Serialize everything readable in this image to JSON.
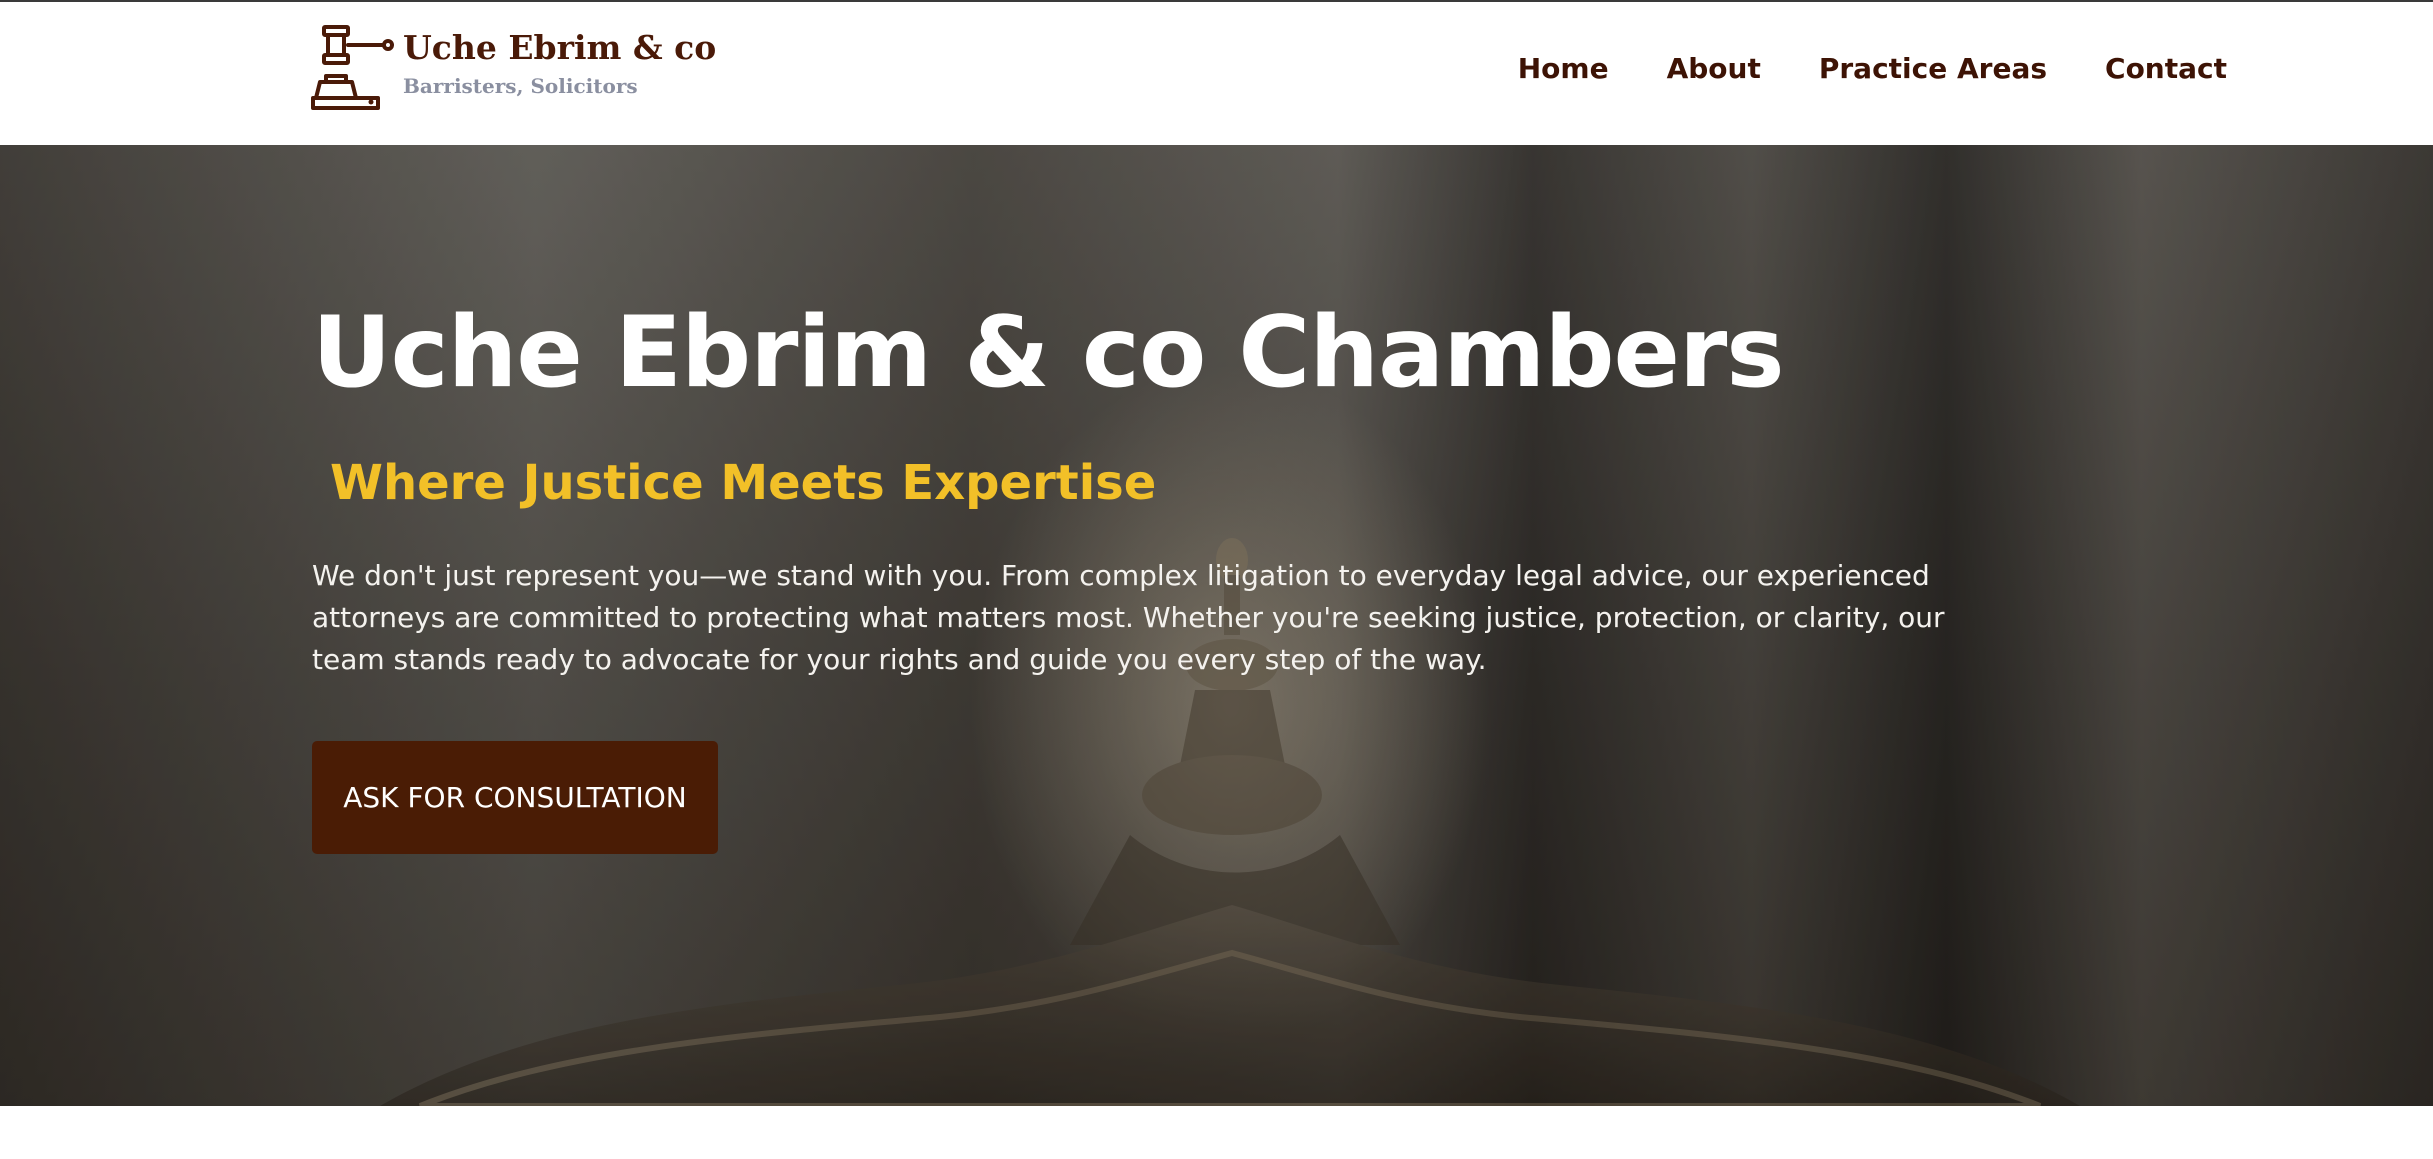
{
  "brand": {
    "name": "Uche Ebrim & co",
    "tagline": "Barristers, Solicitors",
    "logo_icon": "gavel-icon",
    "color": "#4a1a08"
  },
  "nav": {
    "items": [
      {
        "label": "Home"
      },
      {
        "label": "About"
      },
      {
        "label": "Practice Areas"
      },
      {
        "label": "Contact"
      }
    ],
    "color": "#3d1305"
  },
  "hero": {
    "title": "Uche Ebrim & co Chambers",
    "subtitle": "Where Justice Meets Expertise",
    "description": "We don't just represent you—we stand with you. From complex litigation to everyday legal advice, our experienced attorneys are committed to protecting what matters most. Whether you're seeking justice, protection, or clarity, our team stands ready to advocate for your rights and guide you every step of the way.",
    "cta_label": "ASK FOR CONSULTATION",
    "subtitle_color": "#f2c028",
    "cta_color": "#4a1c05",
    "background_image": "blurred-courtroom-chair-photo"
  }
}
